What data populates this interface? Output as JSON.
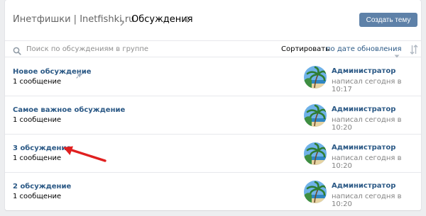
{
  "header": {
    "group_name": "Инетфишки | Inetfishki.ru",
    "current_page": "Обсуждения",
    "topic_count": "4",
    "create_button": "Создать тему"
  },
  "search": {
    "placeholder": "Поиск по обсуждениям в группе",
    "sort_label": "Сортировать",
    "sort_value": "по дате обновления"
  },
  "topics": [
    {
      "title": "Новое обсуждение",
      "pinned": true,
      "messages": "1 сообщение",
      "author": "Администратор",
      "time": "написал сегодня в 10:17"
    },
    {
      "title": "Самое важное обсуждение",
      "pinned": false,
      "messages": "1 сообщение",
      "author": "Администратор",
      "time": "написал сегодня в 10:20"
    },
    {
      "title": "3 обсуждение",
      "pinned": false,
      "messages": "1 сообщение",
      "author": "Администратор",
      "time": "написал сегодня в 10:20"
    },
    {
      "title": "2 обсуждение",
      "pinned": false,
      "messages": "1 сообщение",
      "author": "Администратор",
      "time": "написал сегодня в 10:20"
    }
  ],
  "colors": {
    "accent": "#5e81a8",
    "link": "#2a5885",
    "annotation_arrow": "#e02020",
    "background": "#edeef0"
  },
  "icons": [
    "search-icon",
    "chevron-right-icon",
    "chevron-down-icon",
    "sort-order-icon",
    "pin-icon",
    "arrow-annotation"
  ]
}
